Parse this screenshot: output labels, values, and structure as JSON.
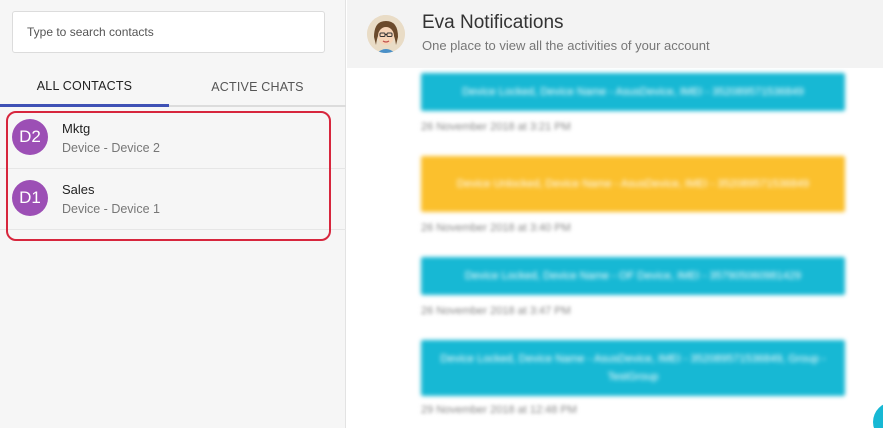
{
  "search": {
    "placeholder": "Type to search contacts"
  },
  "tabs": [
    {
      "label": "ALL CONTACTS",
      "selected": true
    },
    {
      "label": "ACTIVE CHATS",
      "selected": false
    }
  ],
  "contacts": [
    {
      "initials": "D2",
      "name": "Mktg",
      "subtitle": "Device - Device 2"
    },
    {
      "initials": "D1",
      "name": "Sales",
      "subtitle": "Device - Device 1"
    }
  ],
  "header": {
    "title": "Eva Notifications",
    "subtitle": "One place to view all the activities of your account"
  },
  "notifications": [
    {
      "text": "Device Locked, Device Name - AsusDevice, IMEI - 352089571536849",
      "time": "26 November 2018 at 3:21 PM",
      "color": "#17b8d4"
    },
    {
      "text": "Device Unlocked, Device Name - AsusDevice, IMEI - 352089571536849",
      "time": "26 November 2018 at 3:40 PM",
      "color": "#fbc02d"
    },
    {
      "text": "Device Locked, Device Name - OF Device, IMEI - 357905060981429",
      "time": "26 November 2018 at 3:47 PM",
      "color": "#17b8d4"
    },
    {
      "text": "Device Locked, Device Name - AsusDevice, IMEI - 352089571536849, Group - TestGroup",
      "time": "29 November 2018 at 12:48 PM",
      "color": "#17b8d4"
    }
  ],
  "colors": {
    "accent": "#3f51b5",
    "avatar": "#9c4fb5",
    "highlight": "#d7263d"
  }
}
